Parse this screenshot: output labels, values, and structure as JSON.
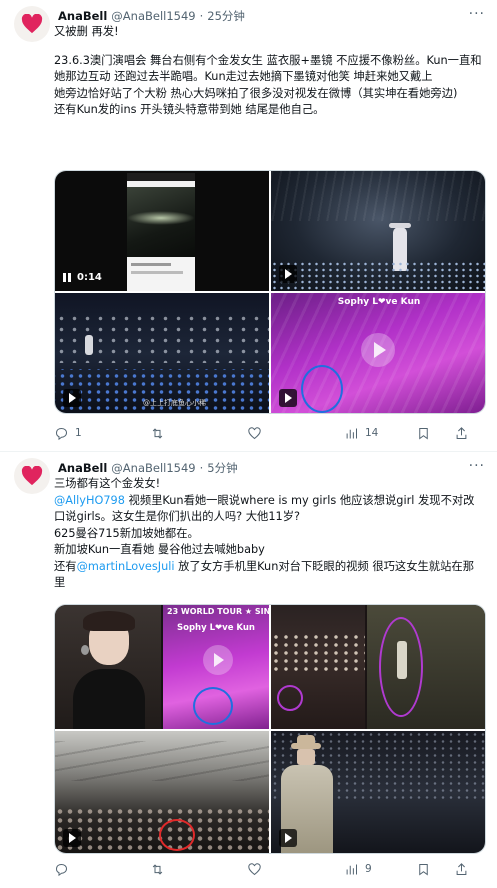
{
  "tweets": [
    {
      "name": "AnaBell",
      "handle": "@AnaBell1549",
      "sep": "·",
      "time": "25分钟",
      "more": "···",
      "lines": [
        "又被删 再发!",
        "",
        "23.6.3澳门演唱会 舞台右侧有个金发女生 蓝衣服+墨镜 不应援不像粉丝。Kun一直和她那边互动 还跑过去半跪唱。Kun走过去她摘下墨镜对他笑 坤赶来她又戴上",
        "她旁边恰好站了个大粉 热心大妈咪拍了很多没对视发在微博（其实坤在看她旁边)",
        "还有Kun发的ins 开头镜头特意带到她 结尾是他自己。"
      ],
      "media": {
        "video_time": "0:14",
        "overlay_text": "Sophy L❤ve Kun",
        "watermark": "@上上打底鱼心小稀"
      },
      "actions": {
        "replies": "1",
        "retweets": "",
        "likes": "",
        "views": "14"
      }
    },
    {
      "name": "AnaBell",
      "handle": "@AnaBell1549",
      "sep": "·",
      "time": "5分钟",
      "more": "···",
      "l1": "三场都有这个金发女!",
      "l2_mention": "@AllyHO798",
      "l2_text": " 视频里Kun看她一眼说where is my girls 他应该想说girl 发现不对改口说girls。这女生是你们扒出的人吗? 大他11岁?",
      "l3": "625曼谷715新加坡她都在。",
      "l4": "新加坡Kun一直看她 曼谷他过去喊她baby",
      "l5_pre": "还有",
      "l5_mention": "@martinLovesJuli",
      "l5_text": " 放了女方手机里Kun对台下眨眼的视频 很巧这女生就站在那里",
      "media": {
        "banner_text": "23 WORLD TOUR ★ SIN",
        "overlay_text": "Sophy L❤ve Kun"
      },
      "actions": {
        "replies": "",
        "retweets": "",
        "likes": "",
        "views": "9"
      }
    }
  ],
  "colors": {
    "link": "#1d9bf0",
    "muted": "#536471",
    "heart": "#e0245e"
  }
}
